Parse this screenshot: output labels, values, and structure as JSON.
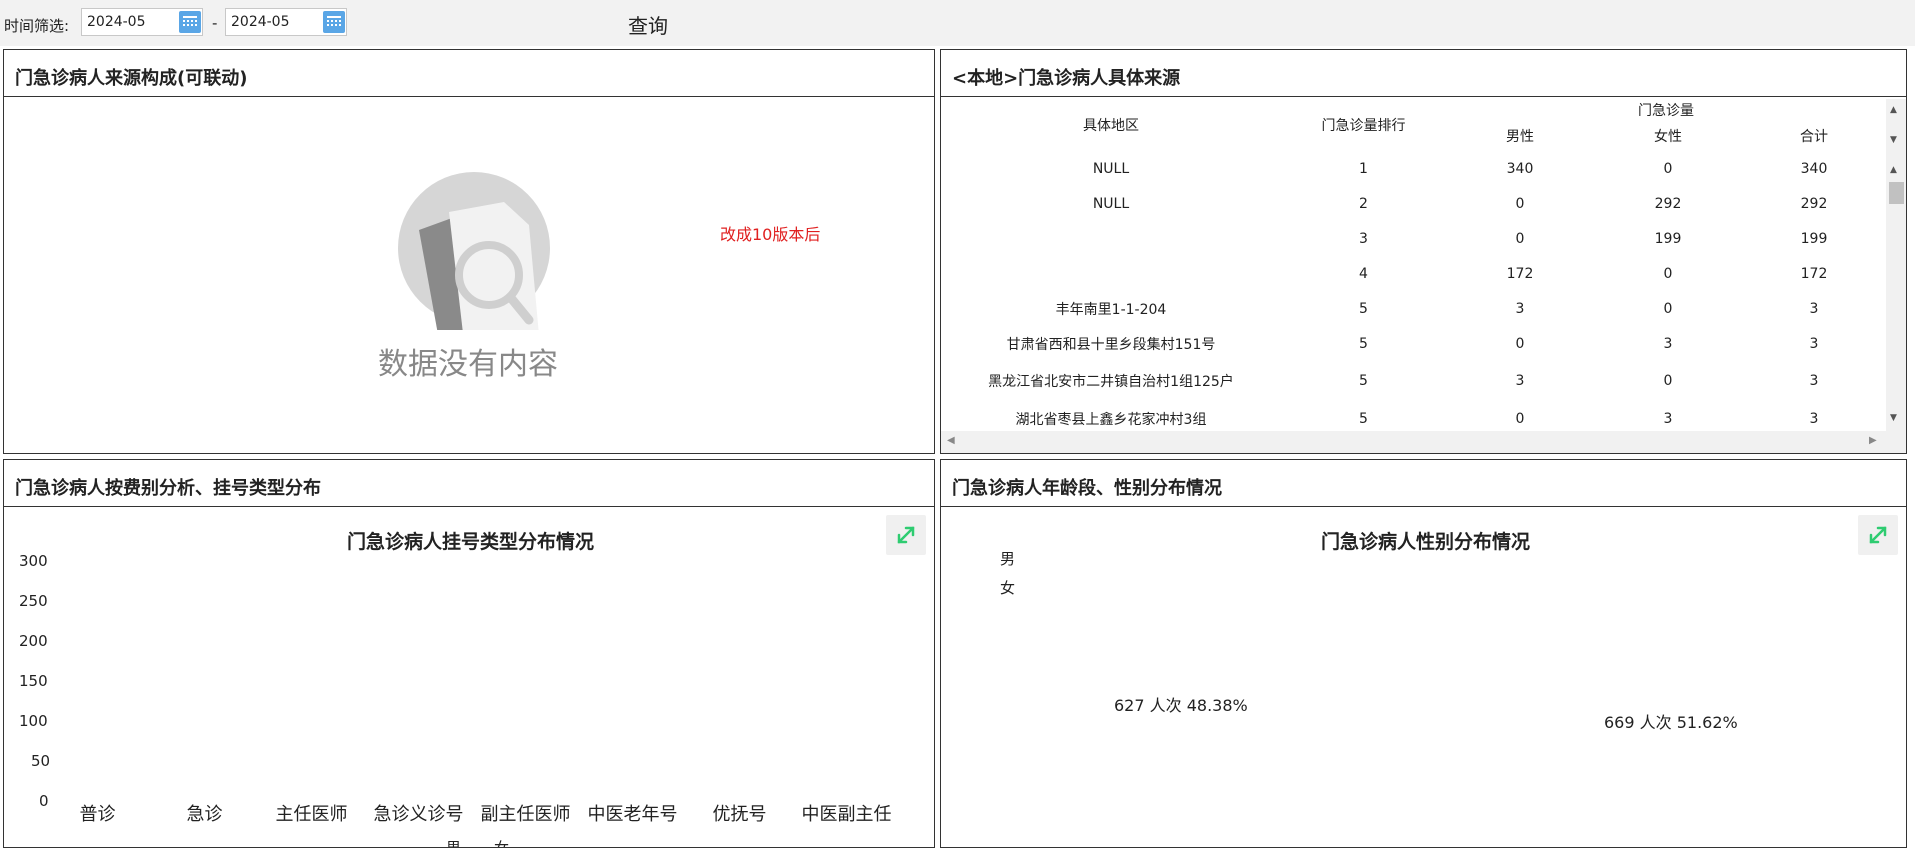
{
  "filter": {
    "label": "时间筛选:",
    "start_date": "2024-05",
    "end_date": "2024-05",
    "separator": "-",
    "query_label": "查询",
    "calendar_icon": "calendar-icon"
  },
  "panel_source": {
    "title": "门急诊病人来源构成(可联动)",
    "no_data_text": "数据没有内容",
    "note": "改成10版本后"
  },
  "panel_local": {
    "title": "<本地>门急诊病人具体来源",
    "headers": {
      "region": "具体地区",
      "rank": "门急诊量排行",
      "volume": "门急诊量",
      "male": "男性",
      "female": "女性",
      "total": "合计"
    },
    "rows": [
      {
        "region": "NULL",
        "rank": "1",
        "male": "340",
        "female": "0",
        "total": "340"
      },
      {
        "region": "NULL",
        "rank": "2",
        "male": "0",
        "female": "292",
        "total": "292"
      },
      {
        "region": "",
        "rank": "3",
        "male": "0",
        "female": "199",
        "total": "199"
      },
      {
        "region": "",
        "rank": "4",
        "male": "172",
        "female": "0",
        "total": "172"
      },
      {
        "region": "丰年南里1-1-204",
        "rank": "5",
        "male": "3",
        "female": "0",
        "total": "3"
      },
      {
        "region": "甘肃省西和县十里乡段集村151号",
        "rank": "5",
        "male": "0",
        "female": "3",
        "total": "3"
      },
      {
        "region": "黑龙江省北安市二井镇自治村1组125户",
        "rank": "5",
        "male": "3",
        "female": "0",
        "total": "3"
      },
      {
        "region": "湖北省枣县上鑫乡花家冲村3组",
        "rank": "5",
        "male": "0",
        "female": "3",
        "total": "3"
      }
    ]
  },
  "panel_fee": {
    "title": "门急诊病人按费别分析、挂号类型分布",
    "expand_icon": "expand-icon"
  },
  "panel_age": {
    "title": "门急诊病人年龄段、性别分布情况",
    "expand_icon": "expand-icon"
  },
  "chart_data": [
    {
      "type": "bar",
      "title": "门急诊病人挂号类型分布情况",
      "categories": [
        "普诊",
        "急诊",
        "主任医师",
        "急诊义诊号",
        "副主任医师",
        "中医老年号",
        "优抚号",
        "中医副主任"
      ],
      "y_ticks": [
        "300",
        "250",
        "200",
        "150",
        "100",
        "50",
        "0"
      ],
      "ylim": [
        0,
        300
      ],
      "legend": [
        "男",
        "女"
      ],
      "legend_position": "bottom",
      "series": [
        {
          "name": "男",
          "values": [
            null,
            null,
            null,
            null,
            null,
            null,
            null,
            null
          ]
        },
        {
          "name": "女",
          "values": [
            null,
            null,
            null,
            null,
            null,
            null,
            null,
            null
          ]
        }
      ]
    },
    {
      "type": "pie",
      "title": "门急诊病人性别分布情况",
      "legend": [
        "男",
        "女"
      ],
      "legend_position": "top-left",
      "slices": [
        {
          "name": "男",
          "value": 627,
          "label": "627 人次",
          "percent": "48.38%"
        },
        {
          "name": "女",
          "value": 669,
          "label": "669 人次",
          "percent": "51.62%"
        }
      ]
    }
  ]
}
